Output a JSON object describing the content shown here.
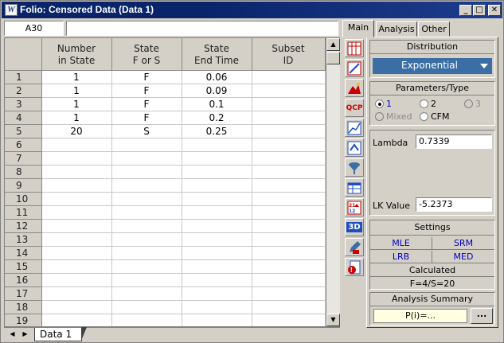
{
  "window": {
    "title_icon": "W",
    "title": "Folio: Censored Data (Data 1)",
    "controls": {
      "minimize": "_",
      "maximize": "□",
      "close": "✕"
    }
  },
  "formula_bar": {
    "cell_ref": "A30",
    "value": ""
  },
  "grid": {
    "columns": [
      {
        "line1": "Number",
        "line2": "in State"
      },
      {
        "line1": "State",
        "line2": "F or S"
      },
      {
        "line1": "State",
        "line2": "End Time"
      },
      {
        "line1": "Subset",
        "line2": "ID"
      }
    ],
    "rows": [
      {
        "n": "1",
        "cells": [
          "1",
          "F",
          "0.06",
          ""
        ]
      },
      {
        "n": "2",
        "cells": [
          "1",
          "F",
          "0.09",
          ""
        ]
      },
      {
        "n": "3",
        "cells": [
          "1",
          "F",
          "0.1",
          ""
        ]
      },
      {
        "n": "4",
        "cells": [
          "1",
          "F",
          "0.2",
          ""
        ]
      },
      {
        "n": "5",
        "cells": [
          "20",
          "S",
          "0.25",
          ""
        ]
      },
      {
        "n": "6",
        "cells": [
          "",
          "",
          "",
          ""
        ]
      },
      {
        "n": "7",
        "cells": [
          "",
          "",
          "",
          ""
        ]
      },
      {
        "n": "8",
        "cells": [
          "",
          "",
          "",
          ""
        ]
      },
      {
        "n": "9",
        "cells": [
          "",
          "",
          "",
          ""
        ]
      },
      {
        "n": "10",
        "cells": [
          "",
          "",
          "",
          ""
        ]
      },
      {
        "n": "11",
        "cells": [
          "",
          "",
          "",
          ""
        ]
      },
      {
        "n": "12",
        "cells": [
          "",
          "",
          "",
          ""
        ]
      },
      {
        "n": "13",
        "cells": [
          "",
          "",
          "",
          ""
        ]
      },
      {
        "n": "14",
        "cells": [
          "",
          "",
          "",
          ""
        ]
      },
      {
        "n": "15",
        "cells": [
          "",
          "",
          "",
          ""
        ]
      },
      {
        "n": "16",
        "cells": [
          "",
          "",
          "",
          ""
        ]
      },
      {
        "n": "17",
        "cells": [
          "",
          "",
          "",
          ""
        ]
      },
      {
        "n": "18",
        "cells": [
          "",
          "",
          "",
          ""
        ]
      },
      {
        "n": "19",
        "cells": [
          "",
          "",
          "",
          ""
        ]
      }
    ]
  },
  "sheet_tabs": [
    {
      "label": "Data 1",
      "active": true
    }
  ],
  "toolbar_icons": [
    "data-sheet-icon",
    "plot-icon",
    "mountain-plot-icon",
    "qcp-calculator-icon",
    "grid-chart-icon",
    "transfer-icon",
    "funnel-icon",
    "table-icon",
    "sort-icon",
    "3d-plot-icon",
    "edit-icon",
    "report-icon"
  ],
  "toolbar_labels": {
    "qcp": "QCP",
    "threed": "3D"
  },
  "panel_tabs": [
    {
      "label": "Main",
      "active": true
    },
    {
      "label": "Analysis",
      "active": false
    },
    {
      "label": "Other",
      "active": false
    }
  ],
  "distribution": {
    "title": "Distribution",
    "selected": "Exponential"
  },
  "parameters": {
    "title": "Parameters/Type",
    "options": [
      {
        "label": "1",
        "checked": true,
        "disabled": false
      },
      {
        "label": "2",
        "checked": false,
        "disabled": false
      },
      {
        "label": "3",
        "checked": false,
        "disabled": true
      },
      {
        "label": "Mixed",
        "checked": false,
        "disabled": true
      },
      {
        "label": "CFM",
        "checked": false,
        "disabled": false
      }
    ]
  },
  "results": {
    "lambda_label": "Lambda",
    "lambda_value": "0.7339",
    "lk_label": "LK Value",
    "lk_value": "-5.2373"
  },
  "settings": {
    "title": "Settings",
    "mle": "MLE",
    "srm": "SRM",
    "lrb": "LRB",
    "med": "MED",
    "calculated": "Calculated",
    "counts": "F=4/S=20"
  },
  "analysis_summary": {
    "title": "Analysis Summary",
    "value": "P(i)=...",
    "button": "..."
  },
  "colors": {
    "titlebar": "#0a246a",
    "selection": "#3a6ea5",
    "summary_bg": "#ffffe1",
    "accent_text": "#0000c0"
  }
}
